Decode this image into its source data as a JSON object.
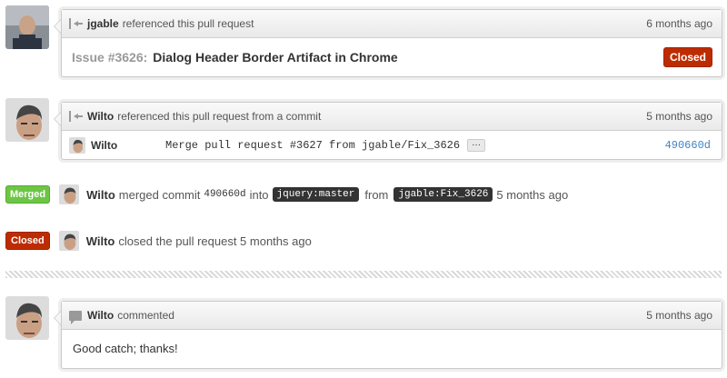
{
  "event1": {
    "user": "jgable",
    "action": "referenced this pull request",
    "time": "6 months ago",
    "issue_number": "Issue #3626:",
    "issue_title": "Dialog Header Border Artifact in Chrome",
    "status": "Closed"
  },
  "event2": {
    "user": "Wilto",
    "action": "referenced this pull request from a commit",
    "time": "5 months ago",
    "commit_author": "Wilto",
    "commit_message": "Merge pull request #3627 from jgable/Fix_3626",
    "ellipsis": "···",
    "sha": "490660d"
  },
  "merged": {
    "badge": "Merged",
    "user": "Wilto",
    "text_a": "merged commit",
    "sha": "490660d",
    "text_b": "into",
    "base_branch": "jquery:master",
    "text_c": "from",
    "head_branch": "jgable:Fix_3626",
    "time": "5 months ago"
  },
  "closed": {
    "badge": "Closed",
    "user": "Wilto",
    "text": "closed the pull request 5 months ago"
  },
  "comment": {
    "user": "Wilto",
    "action": "commented",
    "time": "5 months ago",
    "body": "Good catch; thanks!"
  },
  "colors": {
    "closed": "#bd2c00",
    "merged": "#6cc644",
    "sha_link": "#4183c4"
  }
}
